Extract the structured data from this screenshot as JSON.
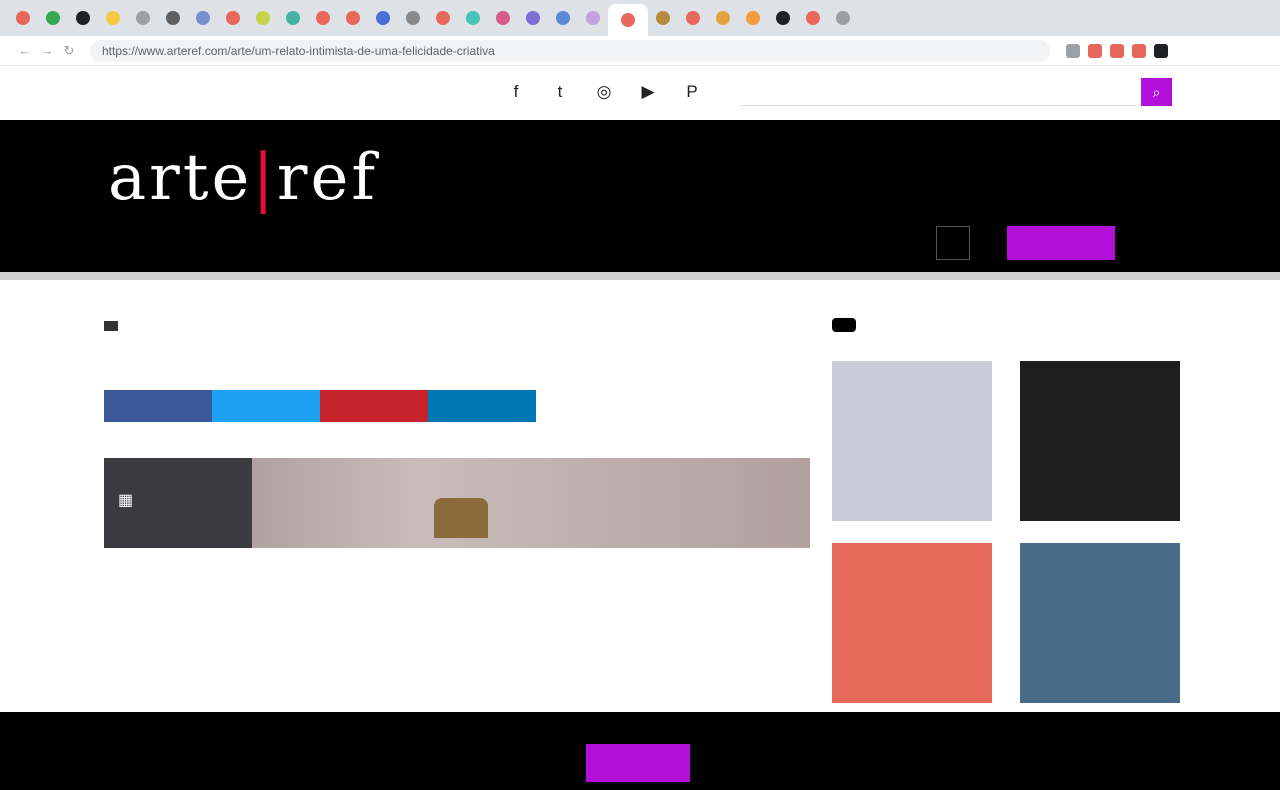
{
  "browser": {
    "tab_colors": [
      "#e8675b",
      "#34a853",
      "#202124",
      "#f6c945",
      "#9aa0a6",
      "#606060",
      "#7a8fd1",
      "#e8675b",
      "#c6d34a",
      "#45b3a3",
      "#e8675b",
      "#e8675b",
      "#4a6fd6",
      "#8a8a8a",
      "#e8675b",
      "#49c2b9",
      "#d85a8a",
      "#7e6ed6",
      "#5a8ad6",
      "#c6a0e0",
      "#e8675b",
      "#b68a3c",
      "#e8675b",
      "#e0a43c",
      "#f29c3c",
      "#202124",
      "#e8675b",
      "#9aa0a6"
    ],
    "nav_back": "←",
    "nav_forward": "→",
    "nav_reload": "↻",
    "url": "https://www.arteref.com/arte/um-relato-intimista-de-uma-felicidade-criativa",
    "extension_colors": [
      "#9aa0a6",
      "#e8675b",
      "#e8675b",
      "#e8675b",
      "#202124"
    ]
  },
  "utility": {
    "icons": [
      "facebook-icon",
      "twitter-icon",
      "instagram-icon",
      "youtube-icon",
      "pinterest-icon"
    ],
    "icon_glyphs": [
      "f",
      "t",
      "◎",
      "▶",
      "P"
    ],
    "search_placeholder": "",
    "search_button": "⌕"
  },
  "masthead": {
    "logo_left": "arte",
    "logo_bar": "|",
    "logo_right": "ref",
    "tagline": "",
    "nav": [
      "",
      "",
      "",
      "",
      "",
      "",
      ""
    ],
    "login": "",
    "subscribe": ""
  },
  "article": {
    "kicker": "",
    "headline": "",
    "deck": "",
    "byline": "",
    "utility_labels": [
      "",
      ""
    ],
    "share": [
      {
        "label": "",
        "color": "#3b5998"
      },
      {
        "label": "",
        "color": "#1da1f2"
      },
      {
        "label": "",
        "color": "#c8232c"
      },
      {
        "label": "",
        "color": "#0077b5"
      }
    ]
  },
  "sidebar": {
    "heading": "",
    "cards": [
      {
        "caption": "",
        "color": "#c9ccd6"
      },
      {
        "caption": "",
        "color": "#1e1e1e"
      },
      {
        "caption": "",
        "color": "#e56a5a"
      },
      {
        "caption": "",
        "color": "#4a6a8a"
      }
    ]
  },
  "cookie": {
    "text": "",
    "button": ""
  }
}
